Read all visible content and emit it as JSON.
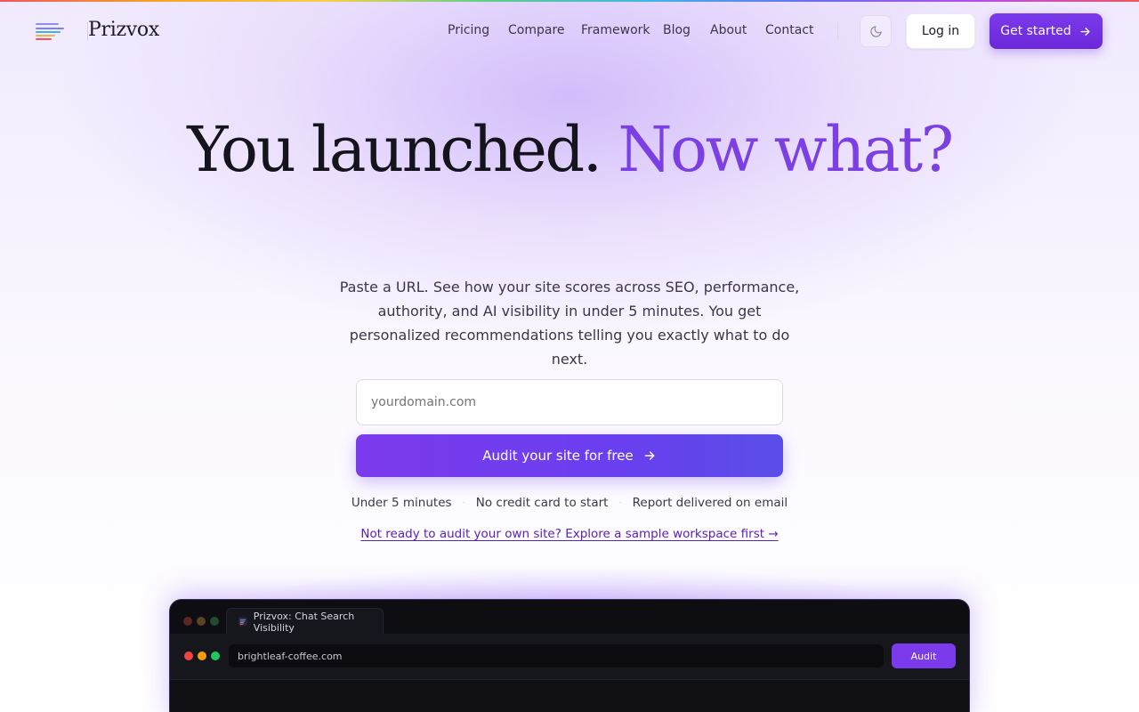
{
  "brand": {
    "name": "Prizvox",
    "logo_colors": [
      "#7c83f0",
      "#3fb5e6",
      "#f2b44a",
      "#f2545b",
      "#b44df0"
    ]
  },
  "nav": {
    "items": [
      "Pricing",
      "Compare",
      "Framework",
      "Blog",
      "About",
      "Contact"
    ],
    "theme_icon": "moon-icon",
    "login_label": "Log in",
    "cta_label": "Get started",
    "cta_icon": "arrow-right-icon"
  },
  "hero": {
    "title_main": "You launched.",
    "title_accent": "Now what?",
    "subtitle": "Paste a URL. See how your site scores across SEO, performance, authority, and AI visibility in under 5 minutes. You get personalized recommendations telling you exactly what to do next.",
    "input_placeholder": "yourdomain.com",
    "input_value": "",
    "audit_label": "Audit your site for free",
    "audit_icon": "arrow-right-icon",
    "benefits": [
      "Under 5 minutes",
      "No credit card to start",
      "Report delivered on email"
    ],
    "sample_link": "Not ready to audit your own site? Explore a sample workspace first →"
  },
  "preview": {
    "tab_title": "Prizvox: Chat Search Visibility",
    "tab_icon": "prizvox-logo-icon",
    "url": "brightleaf-coffee.com",
    "audit_label": "Audit",
    "window_dot_colors": [
      "#ef4444",
      "#f59e0b",
      "#22c55e"
    ]
  },
  "colors": {
    "accent": "#7b3fe4",
    "primary_button": "#7c3aed",
    "link": "#5b21b6"
  }
}
